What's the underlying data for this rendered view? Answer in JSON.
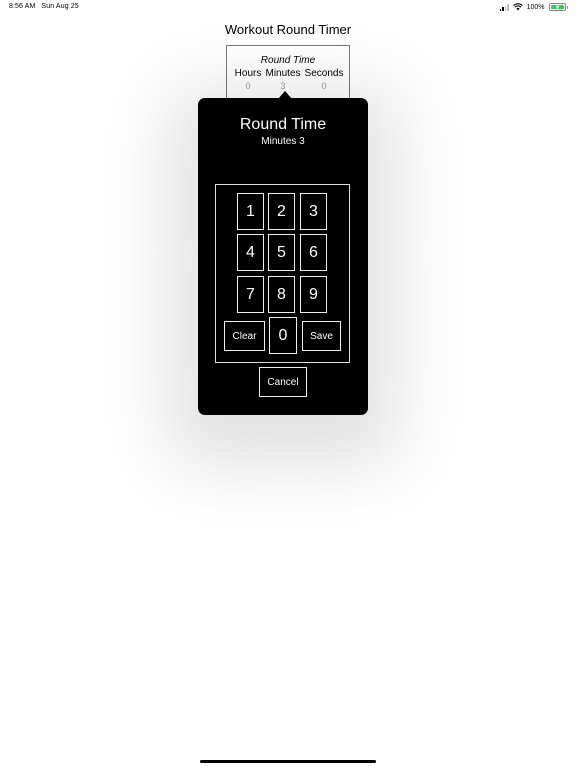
{
  "status_bar": {
    "time_date": "8:56 AM   Sun Aug 25",
    "battery_percent": "100%",
    "battery_level": 1.0,
    "charging": true
  },
  "app": {
    "title": "Workout Round Timer"
  },
  "round_box": {
    "title": "Round Time",
    "columns": [
      {
        "label": "Hours",
        "value": "0"
      },
      {
        "label": "Minutes",
        "value": "3"
      },
      {
        "label": "Seconds",
        "value": "0"
      }
    ]
  },
  "popover": {
    "title": "Round Time",
    "subtitle": "Minutes 3",
    "keys": [
      "1",
      "2",
      "3",
      "4",
      "5",
      "6",
      "7",
      "8",
      "9",
      "0"
    ],
    "clear_label": "Clear",
    "save_label": "Save",
    "cancel_label": "Cancel"
  },
  "colors": {
    "popover_bg": "#000000",
    "battery_fill": "#34c759",
    "value_text": "#9a9a9a"
  }
}
